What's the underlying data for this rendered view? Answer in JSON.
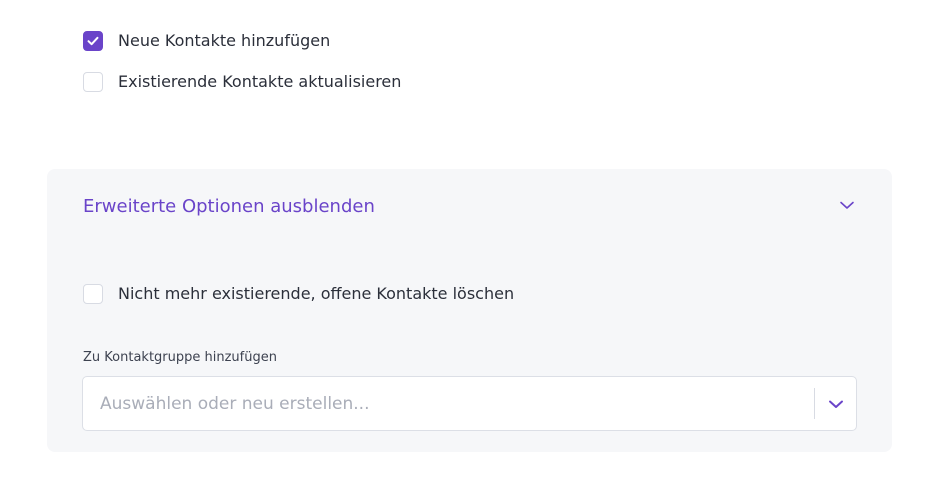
{
  "options": {
    "add_new_contacts": {
      "label": "Neue Kontakte hinzufügen",
      "checked": true
    },
    "update_existing_contacts": {
      "label": "Existierende Kontakte aktualisieren",
      "checked": false
    }
  },
  "advanced": {
    "toggle_label": "Erweiterte Optionen ausblenden",
    "expanded": true,
    "delete_stale": {
      "label": "Nicht mehr existierende, offene Kontakte löschen",
      "checked": false
    },
    "contact_group": {
      "label": "Zu Kontaktgruppe hinzufügen",
      "value": "",
      "placeholder": "Auswählen oder neu erstellen..."
    }
  },
  "colors": {
    "accent": "#6a44c9",
    "panel_background": "#f6f7f9",
    "text": "#2b2f3a",
    "placeholder": "#a9adb8"
  },
  "icons": {
    "check": "check-icon",
    "toggle": "chevron-down-icon",
    "dropdown": "chevron-down-icon"
  }
}
